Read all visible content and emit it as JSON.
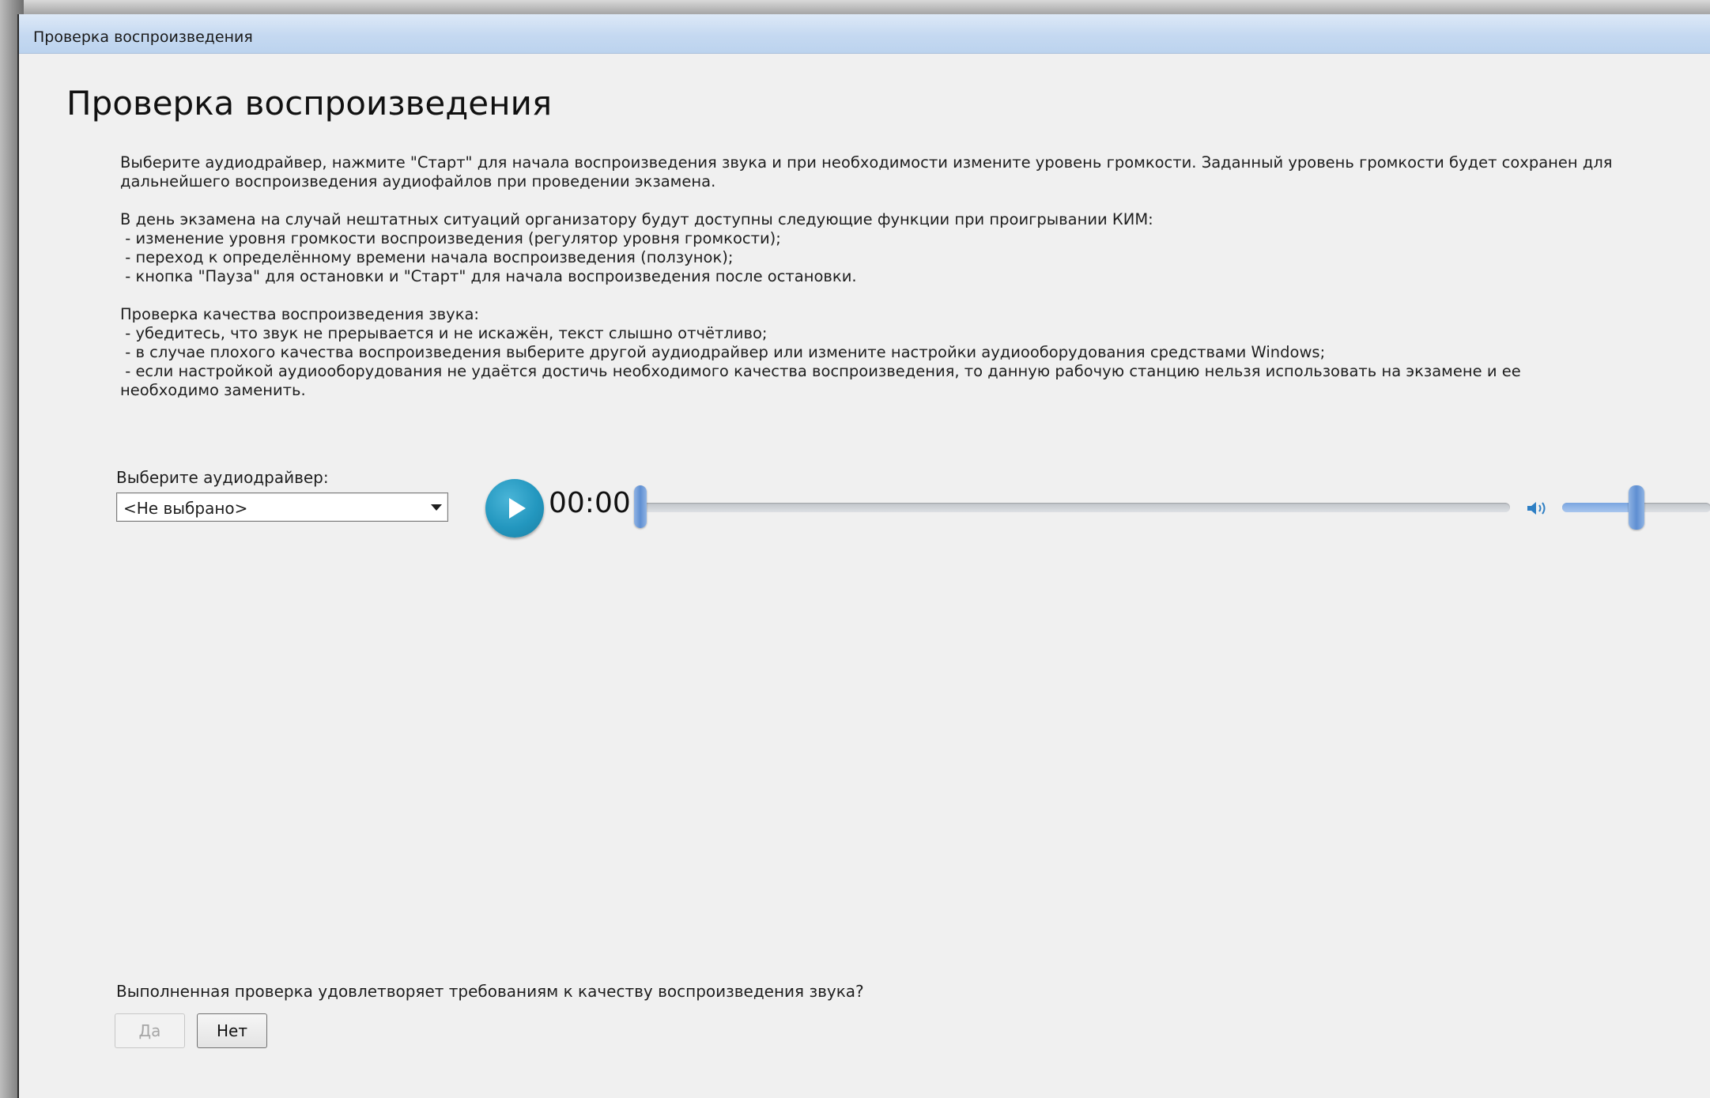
{
  "window": {
    "title": "Проверка воспроизведения"
  },
  "page": {
    "heading": "Проверка воспроизведения",
    "paragraphs": [
      "Выберите аудиодрайвер, нажмите \"Старт\" для начала воспроизведения звука и при необходимости измените уровень громкости. Заданный уровень громкости будет сохранен для дальнейшего воспроизведения аудиофайлов при проведении экзамена.",
      "В день экзамена на случай нештатных ситуаций организатору будут доступны следующие функции при проигрывании КИМ:\n - изменение уровня громкости воспроизведения (регулятор уровня громкости);\n - переход к определённому времени начала воспроизведения (ползунок);\n - кнопка \"Пауза\" для остановки и \"Старт\" для начала воспроизведения после остановки.",
      "Проверка качества воспроизведения звука:\n - убедитесь, что звук не прерывается и не искажён, текст слышно отчётливо;\n - в случае плохого качества воспроизведения выберите другой аудиодрайвер или измените настройки аудиооборудования средствами Windows;\n - если настройкой аудиооборудования не удаётся достичь необходимого качества воспроизведения, то данную рабочую станцию нельзя использовать на экзамене и ее необходимо заменить."
    ]
  },
  "driver": {
    "label": "Выберите аудиодрайвер:",
    "selected": "<Не выбрано>"
  },
  "player": {
    "time": "00:00",
    "position_fraction": 0.0,
    "volume_fraction": 0.5,
    "play_icon": "play-icon",
    "speaker_icon": "speaker-icon",
    "accent_color": "#2397bf"
  },
  "confirm": {
    "question": "Выполненная проверка удовлетворяет требованиям к качеству воспроизведения звука?",
    "yes_label": "Да",
    "no_label": "Нет"
  }
}
